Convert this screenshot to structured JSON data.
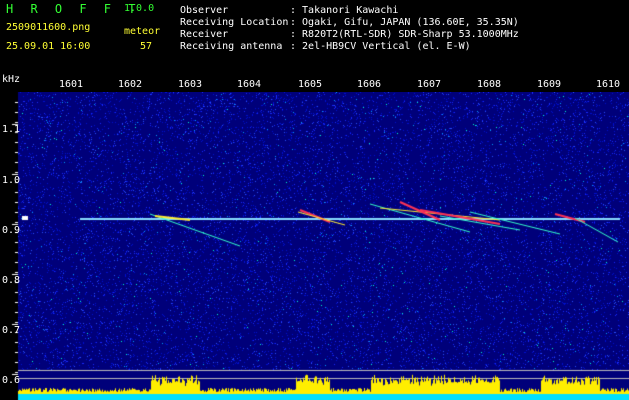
{
  "header": {
    "logo_text": "H R O F F T",
    "version": "1.0.0",
    "filename": "2509011600.png",
    "mode_label": "meteor",
    "datetime": "25.09.01 16:00",
    "count": "57",
    "fields": [
      {
        "label": "Observer",
        "value": ": Takanori Kawachi"
      },
      {
        "label": "Receiving Location",
        "value": ": Ogaki, Gifu, JAPAN (136.60E, 35.35N)"
      },
      {
        "label": "Receiver",
        "value": ": R820T2(RTL-SDR) SDR-Sharp 53.1000MHz"
      },
      {
        "label": "Receiving antenna",
        "value": ": 2el-HB9CV Vertical (el. E-W)"
      }
    ]
  },
  "axes": {
    "unit": "kHz",
    "x_ticks": [
      "1601",
      "1602",
      "1603",
      "1604",
      "1605",
      "1606",
      "1607",
      "1608",
      "1609",
      "1610"
    ],
    "y_ticks": [
      "1.1",
      "1.0",
      "0.9",
      "0.8",
      "0.7",
      "0.6"
    ]
  },
  "colors": {
    "background": "#00007a",
    "carrier": "#88ddff",
    "echo_hot": "#ff3355",
    "echo_warm": "#ffee33",
    "echo_cool": "#33ffcc",
    "baseline_band": "#00e0ff",
    "activity_bars": "#ffee00",
    "header_white": "#ffffff",
    "header_yellow": "#ffff33",
    "logo_green": "#33ff33"
  }
}
